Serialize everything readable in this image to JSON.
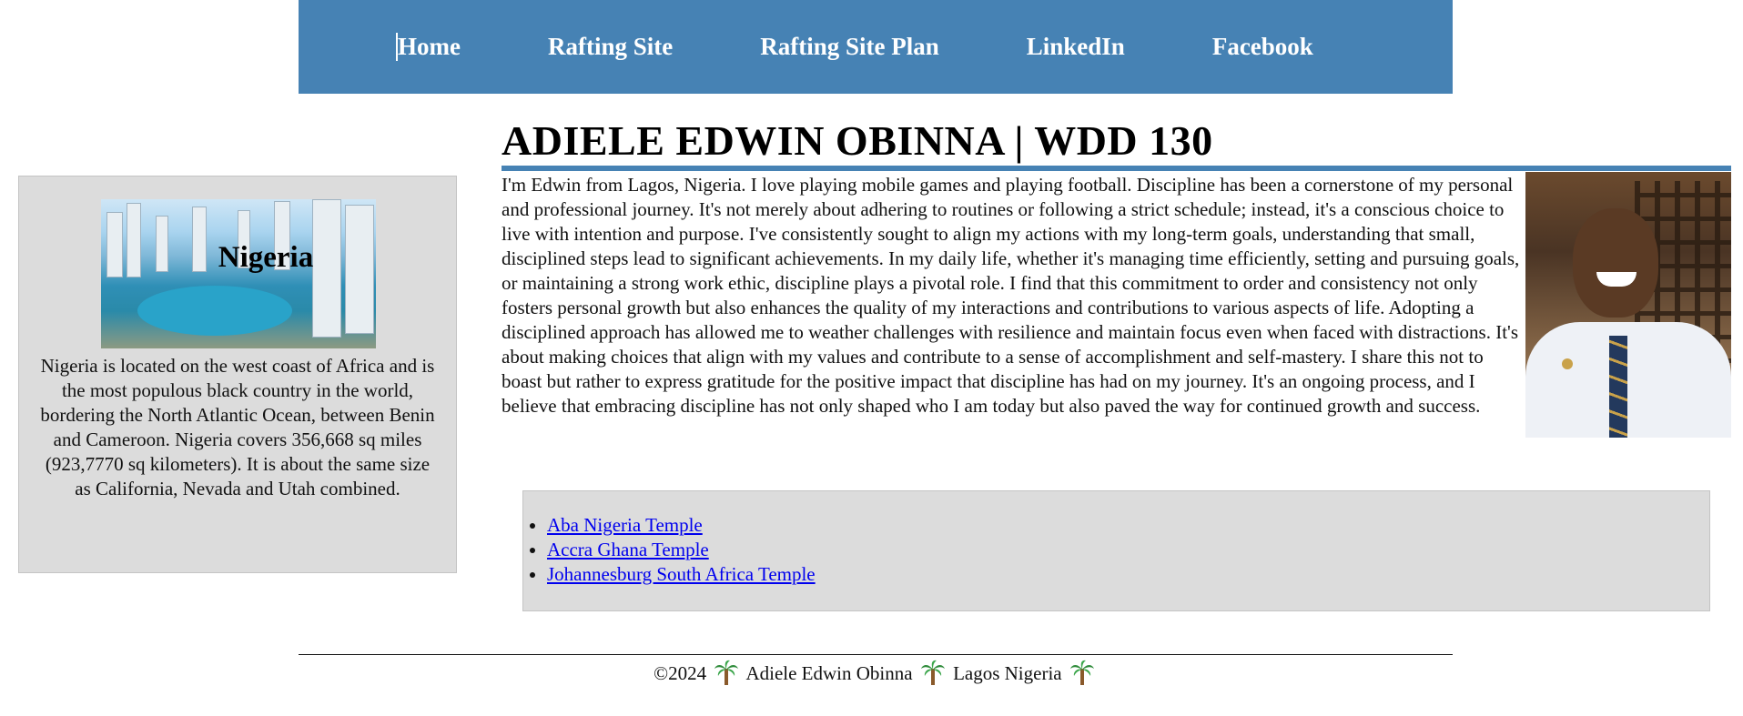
{
  "nav": {
    "items": [
      {
        "label": "Home"
      },
      {
        "label": "Rafting Site"
      },
      {
        "label": "Rafting Site Plan"
      },
      {
        "label": "LinkedIn"
      },
      {
        "label": "Facebook"
      }
    ]
  },
  "sidebar": {
    "image_caption": "Nigeria",
    "text": "Nigeria is located on the west coast of Africa and is the most populous black country in the world, bordering the North Atlantic Ocean, between Benin and Cameroon. Nigeria covers 356,668 sq miles (923,7770 sq kilometers). It is about the same size as California, Nevada and Utah combined."
  },
  "main": {
    "title": "ADIELE EDWIN OBINNA | WDD 130",
    "bio": "I'm Edwin from Lagos, Nigeria. I love playing mobile games and playing football. Discipline has been a cornerstone of my personal and professional journey. It's not merely about adhering to routines or following a strict schedule; instead, it's a conscious choice to live with intention and purpose. I've consistently sought to align my actions with my long-term goals, understanding that small, disciplined steps lead to significant achievements. In my daily life, whether it's managing time efficiently, setting and pursuing goals, or maintaining a strong work ethic, discipline plays a pivotal role. I find that this commitment to order and consistency not only fosters personal growth but also enhances the quality of my interactions and contributions to various aspects of life. Adopting a disciplined approach has allowed me to weather challenges with resilience and maintain focus even when faced with distractions. It's about making choices that align with my values and contribute to a sense of accomplishment and self-mastery. I share this not to boast but rather to express gratitude for the positive impact that discipline has had on my journey. It's an ongoing process, and I believe that embracing discipline has not only shaped who I am today but also paved the way for continued growth and success.",
    "links": [
      {
        "label": "Aba Nigeria Temple"
      },
      {
        "label": "Accra Ghana Temple"
      },
      {
        "label": "Johannesburg South Africa Temple"
      }
    ]
  },
  "footer": {
    "copyright": "©2024",
    "name": "Adiele Edwin Obinna",
    "location": "Lagos Nigeria",
    "icon": "palm-tree-icon"
  },
  "colors": {
    "nav_background": "#4682b4",
    "panel_background": "#dcdcdc",
    "link": "#0000ee"
  }
}
